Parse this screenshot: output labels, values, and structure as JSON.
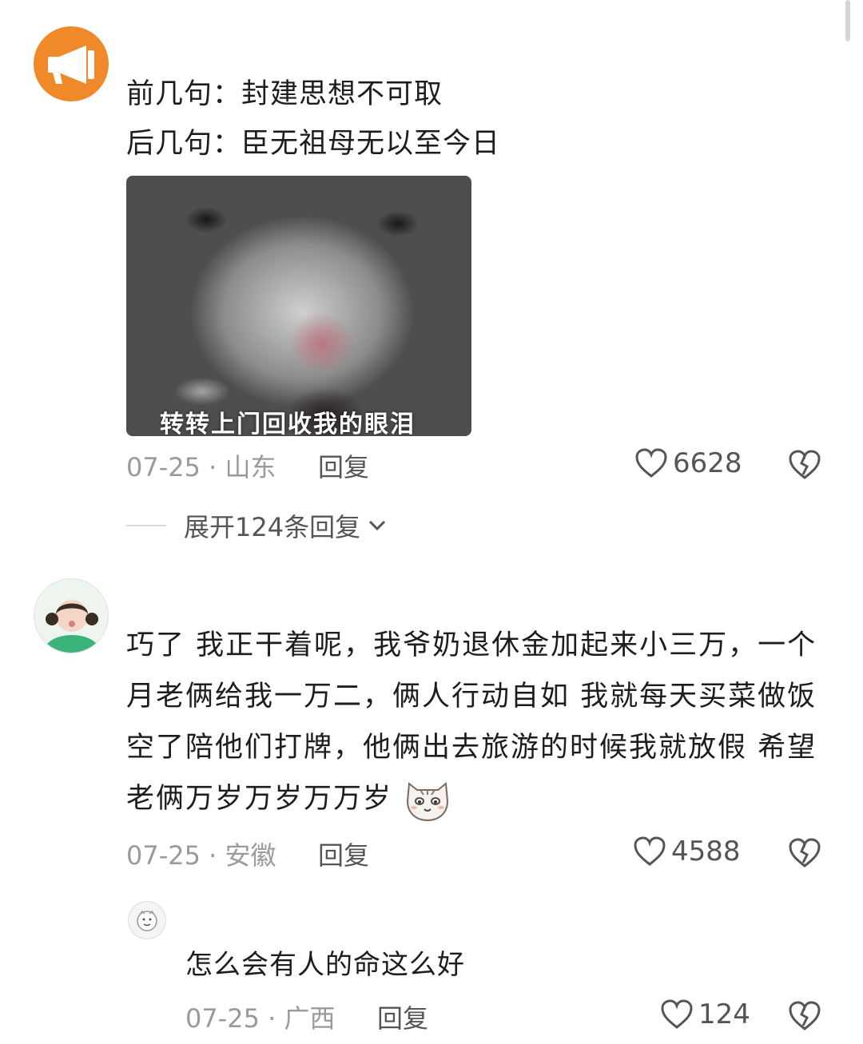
{
  "comments": [
    {
      "lines": [
        "前几句：封建思想不可取",
        "后几句：臣无祖母无以至今日"
      ],
      "image_caption": "转转上门回收我的眼泪",
      "date": "07-25",
      "location": "山东",
      "reply_label": "回复",
      "likes": "6628",
      "expand_replies": "展开124条回复"
    },
    {
      "text": "巧了 我正干着呢，我爷奶退休金加起来小三万，一个月老俩给我一万二，俩人行动自如 我就每天买菜做饭空了陪他们打牌，他俩出去旅游的时候我就放假 希望老俩万岁万岁万万岁",
      "date": "07-25",
      "location": "安徽",
      "reply_label": "回复",
      "likes": "4588"
    }
  ],
  "reply": {
    "text": "怎么会有人的命这么好",
    "date": "07-25",
    "location": "广西",
    "reply_label": "回复",
    "likes": "124"
  },
  "separator": "·",
  "icons": {
    "comment1_avatar": "megaphone-icon",
    "like": "heart-outline-icon",
    "dislike": "broken-heart-icon",
    "expand": "chevron-down-icon",
    "emoji": "cat-face-emoji"
  },
  "colors": {
    "avatar_orange": "#f0892a",
    "meta_gray": "#9a9a9a"
  }
}
